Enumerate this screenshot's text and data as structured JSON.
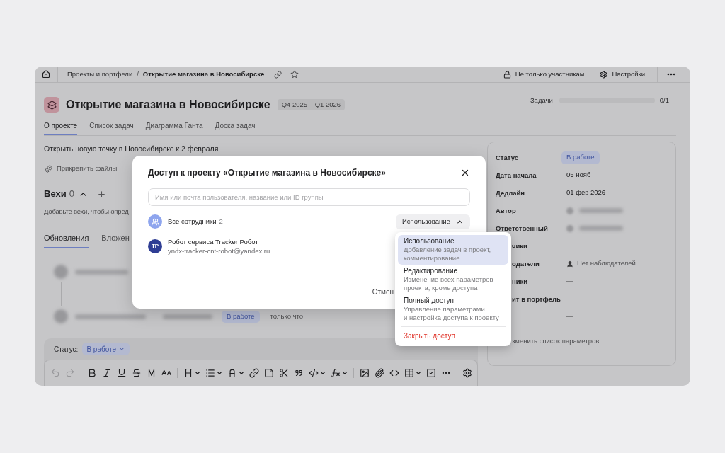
{
  "top_bar": {
    "breadcrumbs": [
      "Проекты и портфели",
      "Открытие магазина в Новосибирске"
    ],
    "separator": "/",
    "access_button": "Не только участникам",
    "settings_button": "Настройки"
  },
  "project": {
    "title": "Открытие магазина в Новосибирске",
    "period": "Q4 2025 – Q1 2026",
    "progress": {
      "label": "Задачи",
      "level": 0,
      "reading": "0/1"
    }
  },
  "tabs": [
    {
      "label": "О проекте",
      "selected": true
    },
    {
      "label": "Список задач",
      "selected": false
    },
    {
      "label": "Диаграмма Ганта",
      "selected": false
    },
    {
      "label": "Доска задач",
      "selected": false
    }
  ],
  "description": "Открыть новую точку в Новосибирске к 2 февраля",
  "attach_button": "Прикрепить файлы",
  "milestones": {
    "title": "Вехи",
    "count": "0",
    "expanded": true,
    "hint": "Добавьте вехи, чтобы опред"
  },
  "feed_tabs": [
    {
      "label": "Обновления",
      "selected": true
    },
    {
      "label": "Вложен",
      "selected": false
    }
  ],
  "feed": [
    {
      "kind": "comment"
    },
    {
      "kind": "status_change",
      "status": "В работе",
      "time": "только что"
    }
  ],
  "status_bar": {
    "label": "Статус:",
    "value": "В работе"
  },
  "editor": {
    "undo": {
      "disabled": true
    },
    "redo": {
      "disabled": true
    }
  },
  "details": {
    "fields": [
      {
        "label": "Статус",
        "kind": "badge",
        "value": "В работе"
      },
      {
        "label": "Дата начала",
        "kind": "text",
        "value": "05 нояб"
      },
      {
        "label": "Дедлайн",
        "kind": "text",
        "value": "01 фев 2026"
      },
      {
        "label": "Автор",
        "kind": "hidden_person"
      },
      {
        "label": "Ответственный",
        "kind": "hidden_person"
      }
    ],
    "covered_fields": [
      {
        "label": "чики",
        "kind": "empty",
        "value": "—"
      },
      {
        "label": "одатели",
        "kind": "nobody",
        "value": "Нет наблюдателей"
      },
      {
        "label": "ники",
        "kind": "empty",
        "value": "—"
      },
      {
        "label": "ит в портфель",
        "kind": "empty",
        "value": "—"
      },
      {
        "kind": "empty",
        "value": "—"
      }
    ],
    "covered_edit_link": "зменить список параметров"
  },
  "dialog": {
    "title": "Доступ к проекту «Открытие магазина в Новосибирске»",
    "search": {
      "placeholder": "Имя или почта пользователя, название или ID группы"
    },
    "members": [
      {
        "kind": "group",
        "name": "Все сотрудники",
        "count": "2",
        "role": "Использование",
        "menu_open": true
      },
      {
        "kind": "user",
        "initials": "TP",
        "name": "Робот сервиса Tracker Робот",
        "email": "yndx-tracker-cnt-robot@yandex.ru"
      }
    ],
    "cancel_button": "Отмен"
  },
  "role_menu": {
    "options": [
      {
        "title": "Использование",
        "description": "Добавление задач в проект,\nкомментирование",
        "selected": true
      },
      {
        "title": "Редактирование",
        "description": "Изменение всех параметров\nпроекта, кроме доступа",
        "selected": false
      },
      {
        "title": "Полный доступ",
        "description": "Управление параметрами\nи настройка доступа к проекту",
        "selected": false
      }
    ],
    "revoke": "Закрыть доступ"
  }
}
